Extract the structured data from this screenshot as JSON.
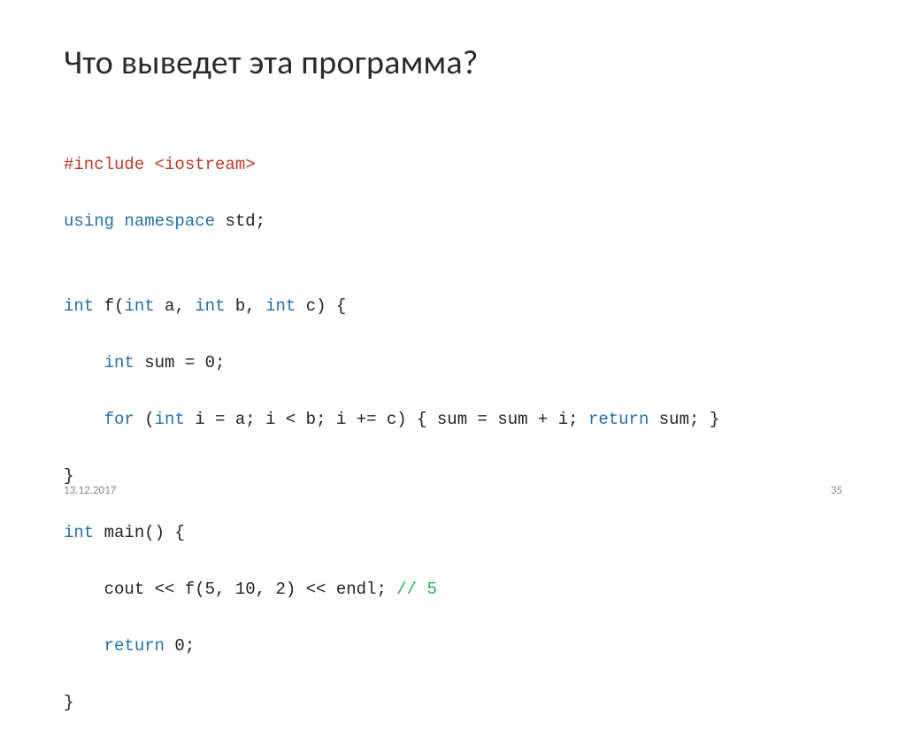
{
  "title": "Что выведет эта программа?",
  "code": {
    "l1": {
      "preproc": "#include",
      "rest": " <iostream>"
    },
    "l2": {
      "kw1": "using",
      "kw2": " namespace",
      "rest": " std;"
    },
    "l3": "",
    "l4": {
      "kw1": "int",
      "t1": " f(",
      "kw2": "int",
      "t2": " a, ",
      "kw3": "int",
      "t3": " b, ",
      "kw4": "int",
      "t4": " c) {"
    },
    "l5": {
      "pad": "    ",
      "kw": "int",
      "rest": " sum = 0;"
    },
    "l6": {
      "pad": "    ",
      "kw1": "for",
      "t1": " (",
      "kw2": "int",
      "t2": " i = a; i < b; i += c) { sum = sum + i; ",
      "kw3": "return",
      "t3": " sum; }"
    },
    "l7": "}",
    "l8": {
      "kw": "int",
      "rest": " main() {"
    },
    "l9": {
      "pad": "    ",
      "t1": "cout << f(5, 10, 2) << endl; ",
      "cm": "// 5"
    },
    "l10": {
      "pad": "    ",
      "kw": "return",
      "rest": " 0;"
    },
    "l11": "}"
  },
  "footer": {
    "date": "13.12.2017",
    "page": "35"
  }
}
